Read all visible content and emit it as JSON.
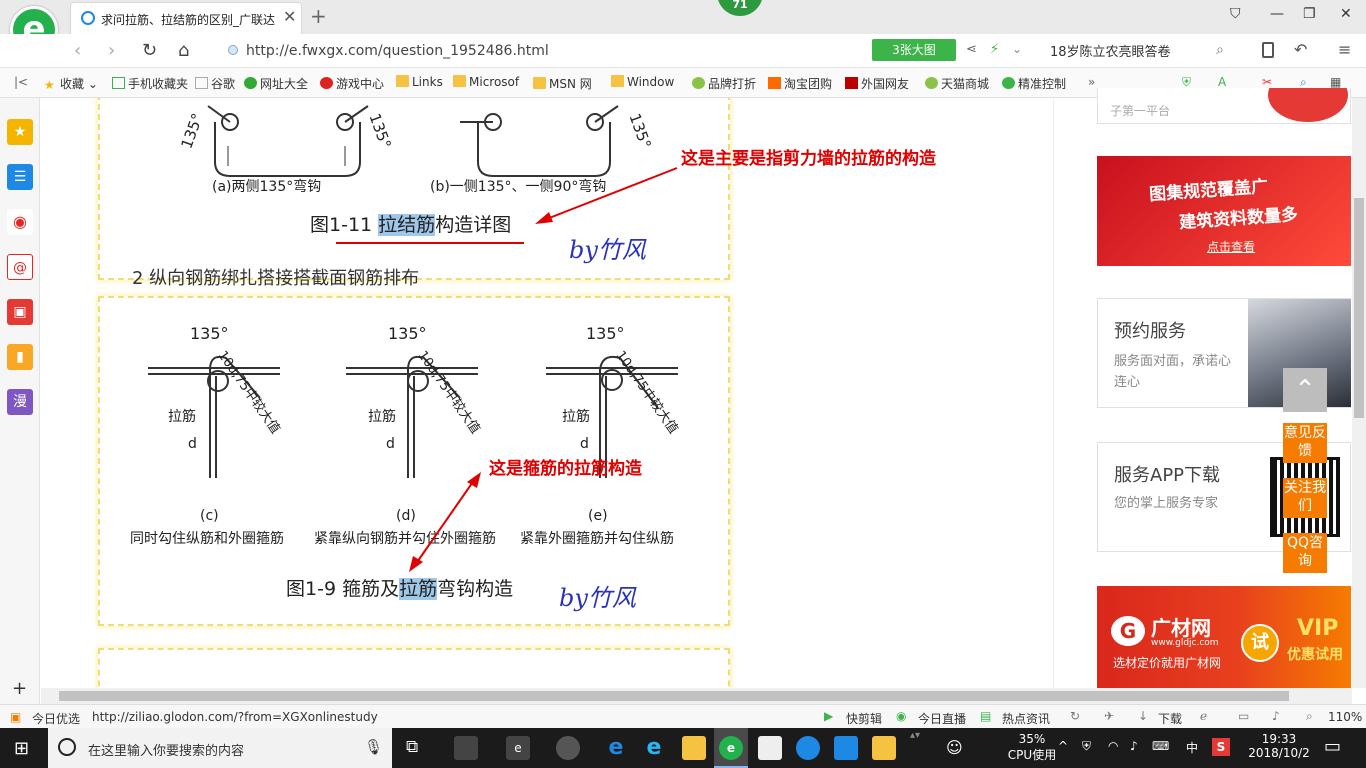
{
  "browser": {
    "tab_title": "求问拉筋、拉结筋的区别_广联达",
    "notification_count": "71",
    "url": "http://e.fwxgx.com/question_1952486.html",
    "pics_button": "3张大图",
    "hot_search": "18岁陈立农亮眼答卷",
    "bookmarks": [
      "收藏",
      "手机收藏夹",
      "谷歌",
      "网址大全",
      "游戏中心",
      "Links",
      "Microsof",
      "MSN 网",
      "Window",
      "品牌打折",
      "淘宝团购",
      "外国网友",
      "天猫商城",
      "精准控制"
    ],
    "bookmarks_more": "»"
  },
  "sidebar": {
    "items": [
      "star-icon",
      "list-icon",
      "weibo-icon",
      "mail-icon",
      "game-icon",
      "book-icon",
      "漫"
    ],
    "add": "+"
  },
  "content": {
    "panel1": {
      "angle1": "135°",
      "angle2": "135°",
      "angle3": "135°",
      "sub_a": "(a)两侧135°弯钩",
      "sub_b": "(b)一侧135°、一侧90°弯钩",
      "caption_prefix": "图1-11 ",
      "caption_highlight": "拉结筋",
      "caption_suffix": "构造详图",
      "next_line": "2  纵向钢筋绑扎搭接搭截面钢筋排布",
      "annotation": "这是主要是指剪力墙的拉筋的构造",
      "signature": "by竹风"
    },
    "panel2": {
      "angle": "135°",
      "ext": "10d,75中较大值",
      "label_lajin": "拉筋",
      "label_d": "d",
      "sub_c": "(c)",
      "sub_d": "(d)",
      "sub_e": "(e)",
      "desc_c": "同时勾住纵筋和外圈箍筋",
      "desc_d": "紧靠纵向钢筋并勾住外圈箍筋",
      "desc_e": "紧靠外圈箍筋并勾住纵筋",
      "caption_prefix": "图1-9 箍筋及",
      "caption_highlight": "拉筋",
      "caption_suffix": "弯钩构造",
      "annotation": "这是箍筋的拉筋构造",
      "signature": "by竹风"
    }
  },
  "right": {
    "top_partial": "子第一平台",
    "ad1_line1": "图集规范覆盖广",
    "ad1_line2": "建筑资料数量多",
    "ad1_button": "点击查看",
    "service1_title": "预约服务",
    "service1_desc": "服务面对面，承诺心连心",
    "service2_title": "服务APP下载",
    "service2_desc": "您的掌上服务专家",
    "ad2_brand": "广材网",
    "ad2_url": "www.gldjc.com",
    "ad2_slogan": "选材定价就用广材网",
    "ad2_try": "试",
    "ad2_vip": "VIP",
    "ad2_vip_sub": "优惠试用",
    "float_feedback": "意见反馈",
    "float_follow": "关注我们",
    "float_qq": "QQ咨询"
  },
  "statusbar": {
    "today": "今日优选",
    "hover_url": "http://ziliao.glodon.com/?from=XGXonlinestudy",
    "quickclip": "快剪辑",
    "live": "今日直播",
    "news": "热点资讯",
    "download": "下载",
    "zoom": "110%"
  },
  "taskbar": {
    "search_placeholder": "在这里输入你要搜索的内容",
    "cpu_percent": "35%",
    "cpu_label": "CPU使用",
    "ime": "中",
    "time": "19:33",
    "date": "2018/10/2"
  },
  "colors": {
    "accent_green": "#3cb44a",
    "annotation_red": "#e00000",
    "signature_blue": "#2a33b8",
    "highlight": "#9fc7ea",
    "orange": "#f57c00"
  }
}
